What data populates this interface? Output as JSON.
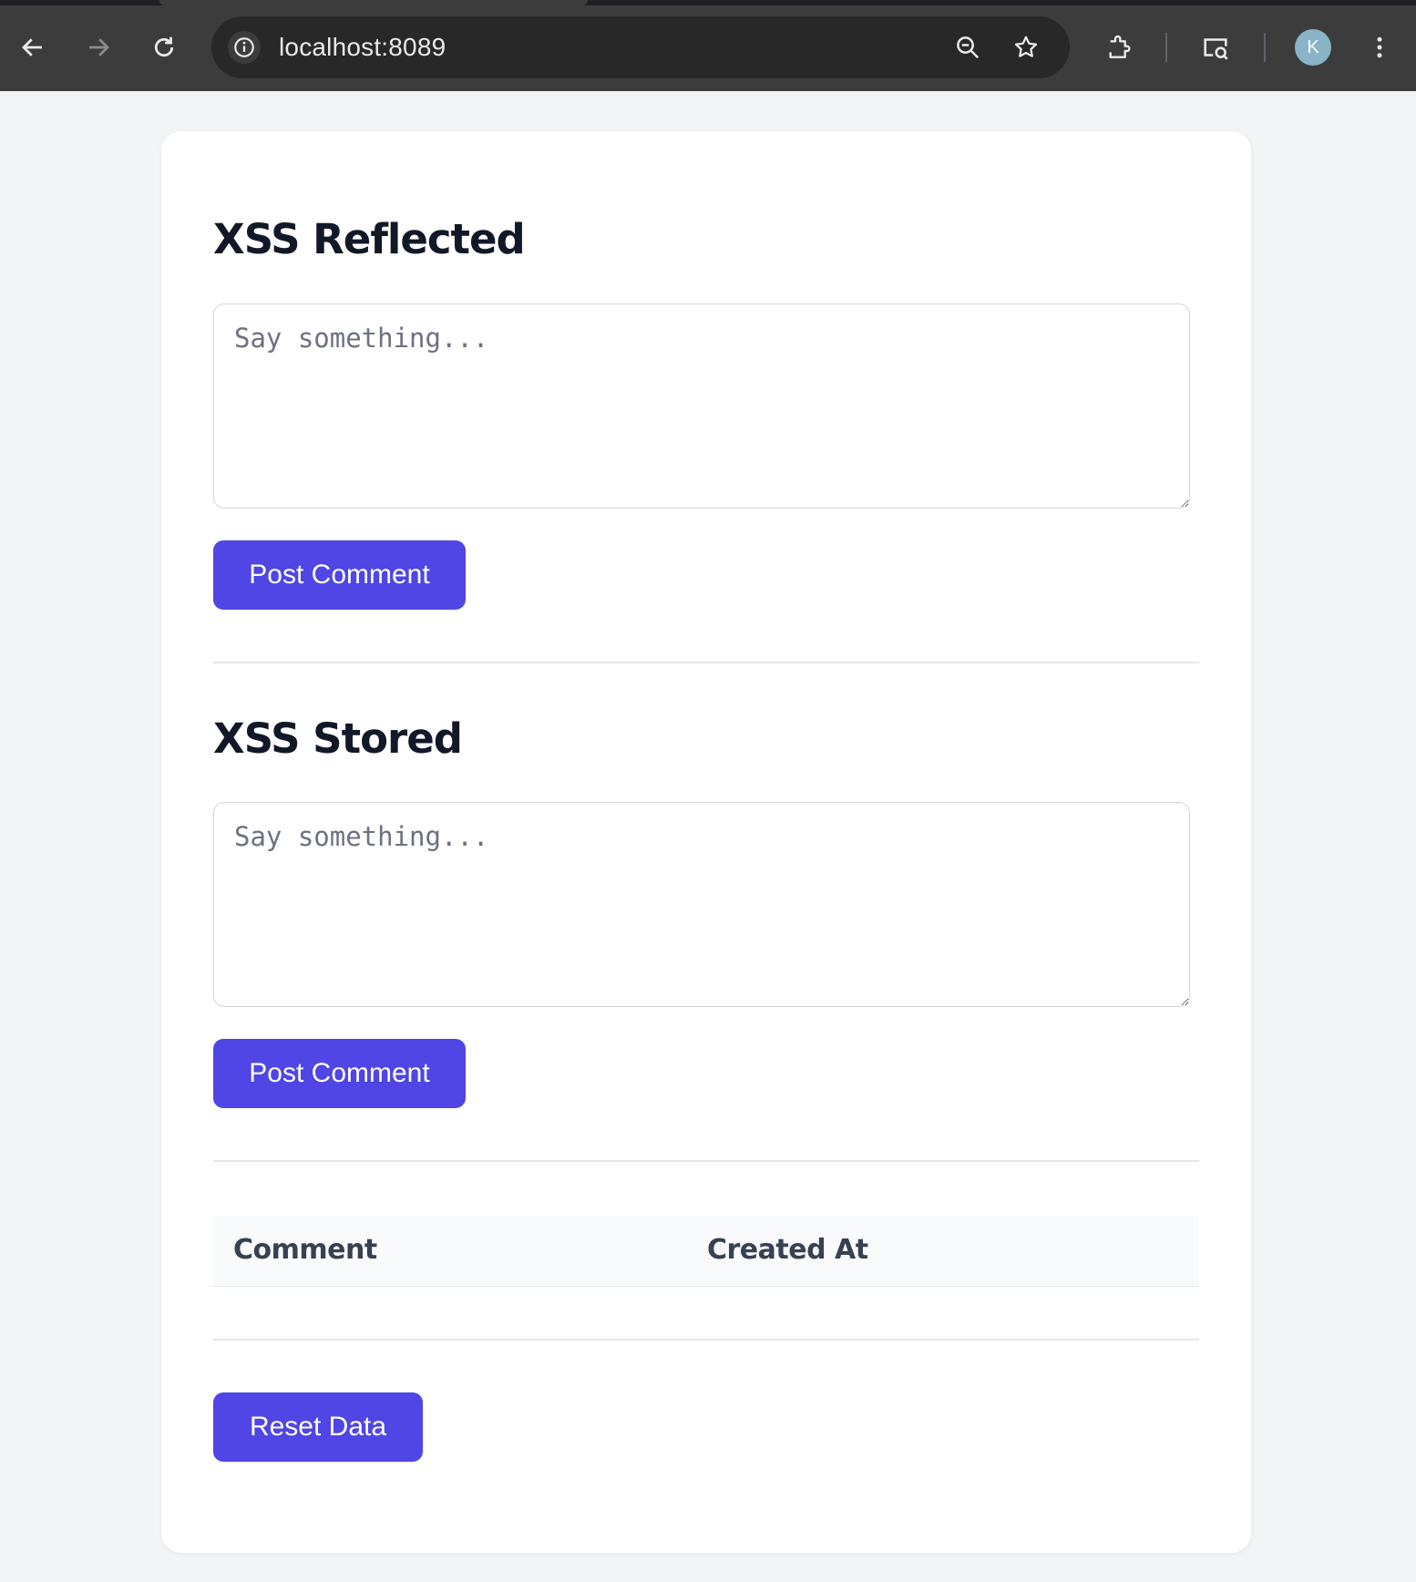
{
  "browser": {
    "url": "localhost:8089",
    "avatar_initial": "K",
    "icons": [
      "back-arrow-icon",
      "forward-arrow-icon",
      "reload-icon",
      "info-icon",
      "zoom-icon",
      "star-icon",
      "extensions-icon",
      "cast-search-icon",
      "more-menu-icon"
    ]
  },
  "reflected": {
    "title": "XSS Reflected",
    "placeholder": "Say something...",
    "button_label": "Post Comment"
  },
  "stored": {
    "title": "XSS Stored",
    "placeholder": "Say something...",
    "button_label": "Post Comment"
  },
  "comments_table": {
    "columns": [
      "Comment",
      "Created At"
    ],
    "rows": []
  },
  "reset_button_label": "Reset Data",
  "colors": {
    "accent": "#4f46e5",
    "page_bg": "#f3f4f6",
    "heading": "#111827",
    "chrome_bg": "#3c3c3c"
  }
}
